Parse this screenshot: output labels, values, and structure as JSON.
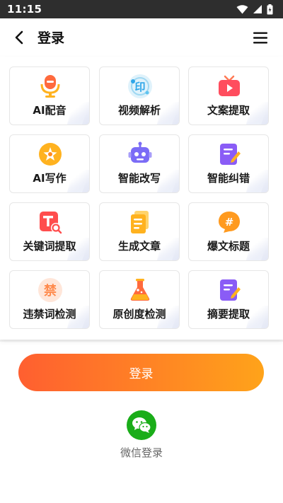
{
  "status_bar": {
    "time": "11:15"
  },
  "nav": {
    "title": "登录",
    "back_icon": "back-arrow-icon",
    "menu_icon": "menu-icon"
  },
  "features": [
    {
      "label": "AI配音",
      "icon": "microphone-icon",
      "color": "#ff6a3d"
    },
    {
      "label": "视频解析",
      "icon": "video-parse-icon",
      "color": "#2fa6e8"
    },
    {
      "label": "文案提取",
      "icon": "tv-play-icon",
      "color": "#ff4d5e"
    },
    {
      "label": "AI写作",
      "icon": "ai-write-star-icon",
      "color": "#ffb21f"
    },
    {
      "label": "智能改写",
      "icon": "robot-icon",
      "color": "#7b6cf6"
    },
    {
      "label": "智能纠错",
      "icon": "edit-document-icon",
      "color": "#8a5cf6"
    },
    {
      "label": "关键词提取",
      "icon": "keyword-search-icon",
      "color": "#ff4d4d"
    },
    {
      "label": "生成文章",
      "icon": "article-icon",
      "color": "#ffb21f"
    },
    {
      "label": "爆文标题",
      "icon": "hashtag-bubble-icon",
      "color": "#ff9a1f"
    },
    {
      "label": "违禁词检测",
      "icon": "forbidden-word-icon",
      "color": "#ff8a4c"
    },
    {
      "label": "原创度检测",
      "icon": "flask-icon",
      "color": "#ff6a3d"
    },
    {
      "label": "摘要提取",
      "icon": "summary-edit-icon",
      "color": "#8a5cf6"
    }
  ],
  "login_button": {
    "label": "登录"
  },
  "wechat_login": {
    "label": "微信登录",
    "icon": "wechat-icon"
  },
  "colors": {
    "accent_start": "#ff5f30",
    "accent_end": "#ffa31a",
    "wechat_green": "#1aad19",
    "status_bar": "#2e2e2e"
  },
  "grid_icon_char": "禁"
}
